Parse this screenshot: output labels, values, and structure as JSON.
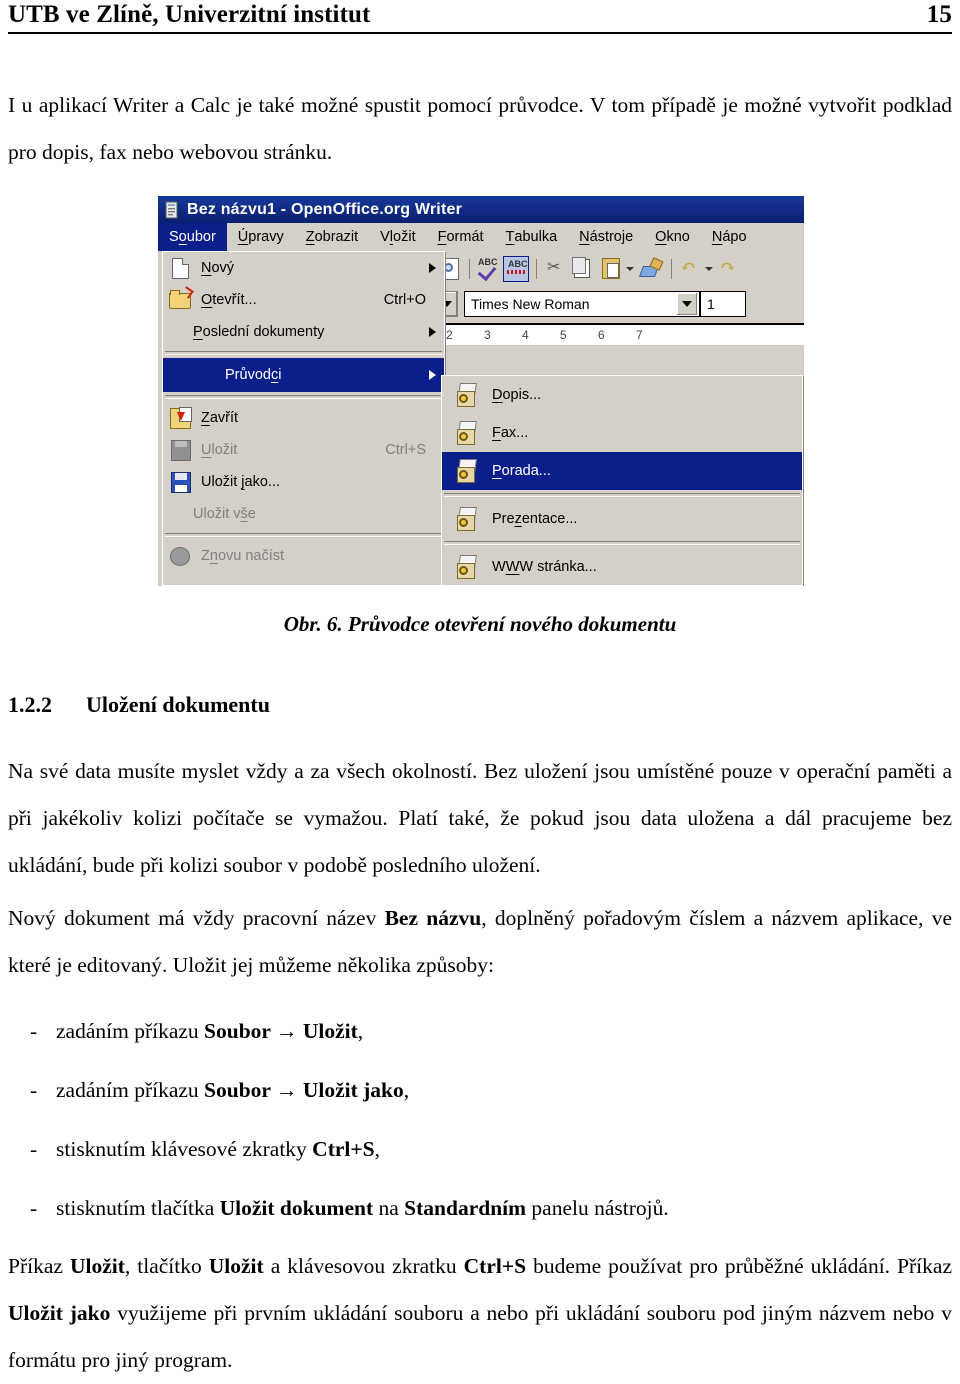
{
  "header": {
    "title": "UTB ve Zlíně, Univerzitní institut",
    "page_number": "15"
  },
  "intro": {
    "text": "I u aplikací Writer a Calc je také možné spustit pomocí průvodce. V tom případě je možné vytvořit podklad pro dopis, fax nebo webovou stránku."
  },
  "figure": {
    "caption": "Obr. 6. Průvodce otevření nového dokumentu",
    "window": {
      "title": "Bez názvu1 - OpenOffice.org Writer",
      "title_icon": "writer-document-icon",
      "titlebar_color": "#0a1f6e",
      "highlight_color": "#0a1f8c",
      "menu_face_color": "#d4d0c8",
      "menubar": [
        {
          "label_pre": "S",
          "label_acc": "o",
          "label_post": "ubor",
          "active": true
        },
        {
          "label_pre": "",
          "label_acc": "Ú",
          "label_post": "pravy",
          "active": false
        },
        {
          "label_pre": "",
          "label_acc": "Z",
          "label_post": "obrazit",
          "active": false
        },
        {
          "label_pre": "V",
          "label_acc": "l",
          "label_post": "ožit",
          "active": false
        },
        {
          "label_pre": "",
          "label_acc": "F",
          "label_post": "ormát",
          "active": false
        },
        {
          "label_pre": "",
          "label_acc": "T",
          "label_post": "abulka",
          "active": false
        },
        {
          "label_pre": "",
          "label_acc": "N",
          "label_post": "ástroje",
          "active": false
        },
        {
          "label_pre": "",
          "label_acc": "O",
          "label_post": "kno",
          "active": false
        },
        {
          "label_pre": "",
          "label_acc": "N",
          "label_post": "ápo",
          "active": false
        }
      ],
      "toolbar": {
        "icons": [
          "page-preview-icon",
          "spellcheck-icon",
          "autospellcheck-icon",
          "cut-icon",
          "copy-icon",
          "paste-icon",
          "clone-formatting-icon",
          "undo-icon"
        ],
        "font_name": "Times New Roman",
        "font_size": "1",
        "ruler_ticks": "2 3 4 5 6 7"
      },
      "file_menu": [
        {
          "icon": "new-document-icon",
          "pre": "",
          "acc": "N",
          "post": "ový",
          "shortcut": "",
          "submenu": true,
          "disabled": false,
          "selected": false
        },
        {
          "icon": "open-folder-icon",
          "pre": "",
          "acc": "O",
          "post": "tevřít...",
          "shortcut": "Ctrl+O",
          "submenu": false,
          "disabled": false,
          "selected": false
        },
        {
          "icon": "",
          "pre": "",
          "acc": "P",
          "post": "oslední dokumenty",
          "shortcut": "",
          "submenu": true,
          "disabled": false,
          "selected": false
        },
        {
          "separator": true
        },
        {
          "icon": "",
          "pre": "Průvod",
          "acc": "c",
          "post": "i",
          "shortcut": "",
          "submenu": true,
          "disabled": false,
          "selected": true
        },
        {
          "separator": true
        },
        {
          "icon": "close-document-icon",
          "pre": "",
          "acc": "Z",
          "post": "avřít",
          "shortcut": "",
          "submenu": false,
          "disabled": false,
          "selected": false
        },
        {
          "icon": "save-disabled-icon",
          "pre": "",
          "acc": "U",
          "post": "ložit",
          "shortcut": "Ctrl+S",
          "submenu": false,
          "disabled": true,
          "selected": false
        },
        {
          "icon": "save-as-icon",
          "pre": "Uložit ",
          "acc": "j",
          "post": "ako...",
          "shortcut": "",
          "submenu": false,
          "disabled": false,
          "selected": false
        },
        {
          "icon": "",
          "pre": "Uložit v",
          "acc": "š",
          "post": "e",
          "shortcut": "",
          "submenu": false,
          "disabled": true,
          "selected": false
        },
        {
          "separator": true
        },
        {
          "icon": "reload-icon",
          "pre": "Z",
          "acc": "n",
          "post": "ovu načíst",
          "shortcut": "",
          "submenu": false,
          "disabled": true,
          "selected": false
        }
      ],
      "wizards_submenu": [
        {
          "icon": "wizard-icon",
          "pre": "",
          "acc": "D",
          "post": "opis...",
          "selected": false
        },
        {
          "icon": "wizard-icon",
          "pre": "",
          "acc": "F",
          "post": "ax...",
          "selected": false
        },
        {
          "icon": "wizard-icon",
          "pre": "",
          "acc": "P",
          "post": "orada...",
          "selected": true
        },
        {
          "separator": true
        },
        {
          "icon": "wizard-icon",
          "pre": "Pre",
          "acc": "z",
          "post": "entace...",
          "selected": false
        },
        {
          "separator": true
        },
        {
          "icon": "wizard-icon",
          "pre": "W",
          "acc": "W",
          "post": "W stránka...",
          "selected": false
        }
      ]
    }
  },
  "section": {
    "number": "1.2.2",
    "title": "Uložení dokumentu"
  },
  "paragraphs": {
    "p1": "Na své data musíte myslet vždy a za všech okolností. Bez uložení jsou umístěné pouze v operační paměti a při jakékoliv kolizi počítače se vymažou. Platí také, že pokud jsou data uložena a dál pracujeme bez ukládání, bude při kolizi soubor v podobě posledního uložení.",
    "p2_a": "Nový dokument má vždy pracovní název ",
    "p2_b": "Bez názvu",
    "p2_c": ", doplněný pořadovým číslem a názvem aplikace, ve které je editovaný. Uložit jej můžeme několika způsoby:",
    "p3_a": "Příkaz ",
    "p3_b": "Uložit",
    "p3_c": ", tlačítko ",
    "p3_d": "Uložit",
    "p3_e": " a klávesovou zkratku ",
    "p3_f": "Ctrl+S",
    "p3_g": " budeme používat pro průběžné ukládání. Příkaz ",
    "p3_h": "Uložit jako",
    "p3_i": " využijeme při prvním ukládání souboru a nebo při ukládání souboru pod jiným názvem nebo v formátu pro jiný program."
  },
  "bullet_list": {
    "marker": "-",
    "items": [
      {
        "a": "zadáním příkazu ",
        "b": "Soubor → Uložit",
        "c": ","
      },
      {
        "a": "zadáním příkazu ",
        "b": "Soubor → Uložit jako",
        "c": ","
      },
      {
        "a": "stisknutím klávesové zkratky ",
        "b": "Ctrl+S",
        "c": ","
      },
      {
        "a": "stisknutím tlačítka ",
        "b": "Uložit dokument",
        "c": " na ",
        "d": "Standardním",
        "e": " panelu nástrojů."
      }
    ]
  }
}
